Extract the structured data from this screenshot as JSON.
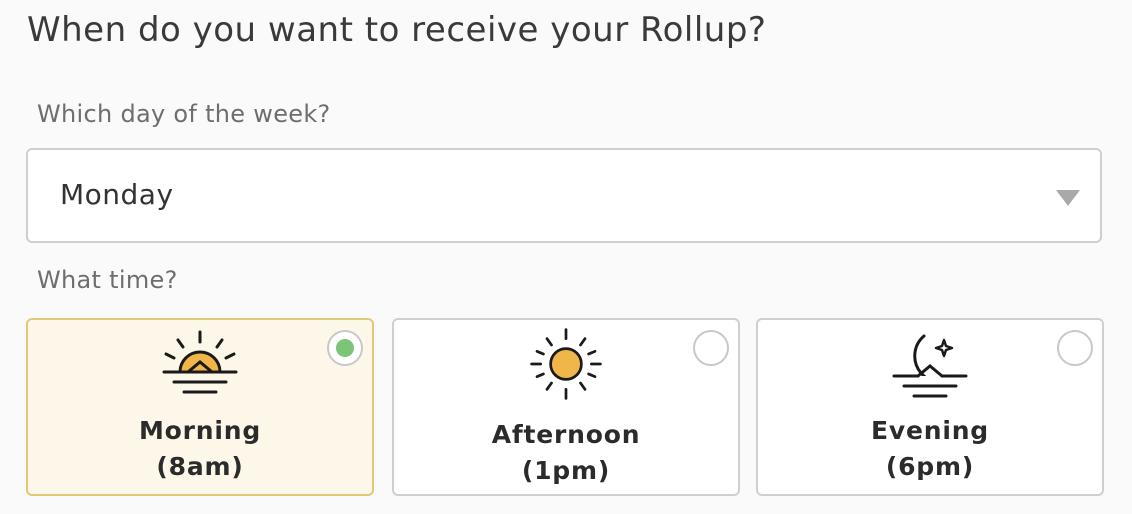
{
  "heading": "When do you want to receive your Rollup?",
  "day_section": {
    "label": "Which day of the week?",
    "selected_value": "Monday"
  },
  "time_section": {
    "label": "What time?",
    "options": [
      {
        "title": "Morning",
        "time": "(8am)",
        "icon": "sunrise-icon",
        "selected": true
      },
      {
        "title": "Afternoon",
        "time": "(1pm)",
        "icon": "sun-icon",
        "selected": false
      },
      {
        "title": "Evening",
        "time": "(6pm)",
        "icon": "moon-icon",
        "selected": false
      }
    ]
  },
  "colors": {
    "selected_card_bg": "#fcf7e8",
    "selected_card_border": "#e2c97a",
    "radio_selected": "#7cc576",
    "sun_fill": "#f0b64a",
    "moon_fill": "#f5e9a0"
  }
}
